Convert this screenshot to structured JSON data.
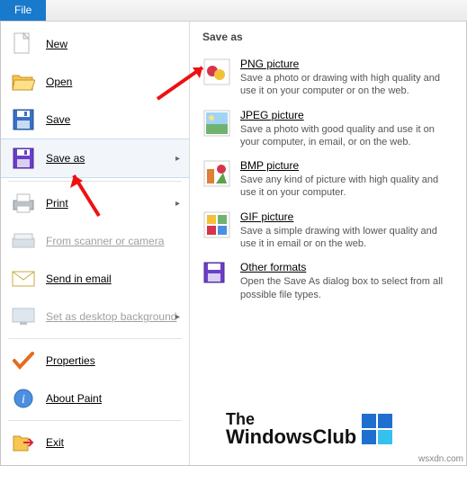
{
  "tab": {
    "file": "File"
  },
  "menu": {
    "new": "New",
    "open": "Open",
    "save": "Save",
    "saveas": "Save as",
    "print": "Print",
    "scanner": "From scanner or camera",
    "email": "Send in email",
    "desktop": "Set as desktop background",
    "properties": "Properties",
    "about": "About Paint",
    "exit": "Exit"
  },
  "panel": {
    "title": "Save as",
    "png": {
      "title": "PNG picture",
      "desc": "Save a photo or drawing with high quality and use it on your computer or on the web."
    },
    "jpeg": {
      "title": "JPEG picture",
      "desc": "Save a photo with good quality and use it on your computer, in email, or on the web."
    },
    "bmp": {
      "title": "BMP picture",
      "desc": "Save any kind of picture with high quality and use it on your computer."
    },
    "gif": {
      "title": "GIF picture",
      "desc": "Save a simple drawing with lower quality and use it in email or on the web."
    },
    "other": {
      "title": "Other formats",
      "desc": "Open the Save As dialog box to select from all possible file types."
    }
  },
  "watermark": {
    "line1": "The",
    "line2": "WindowsClub"
  },
  "credit": "wsxdn.com"
}
